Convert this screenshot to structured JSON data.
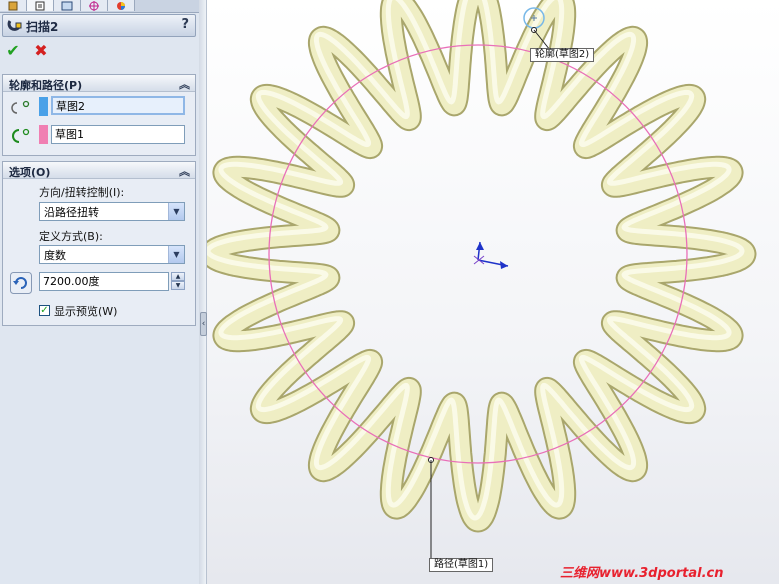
{
  "feature": {
    "title": "扫描2",
    "help": "?"
  },
  "tabs": [
    "feature-manager-icon",
    "property-manager-icon",
    "configuration-manager-icon",
    "dimxpert-icon",
    "display-manager-icon"
  ],
  "profile_path": {
    "header": "轮廓和路径(P)",
    "profile_value": "草图2",
    "path_value": "草图1",
    "profile_color": "#4aa1e8",
    "path_color": "#f07fb2"
  },
  "options": {
    "header": "选项(O)",
    "orientation_label": "方向/扭转控制(I):",
    "orientation_value": "沿路径扭转",
    "define_label": "定义方式(B):",
    "define_value": "度数",
    "degrees_value": "7200.00度",
    "preview_label": "显示预览(W)",
    "preview_checked": true
  },
  "callouts": {
    "profile": "轮廓(草图2)",
    "path": "路径(草图1)"
  },
  "watermark": "三维网www.3dportal.cn",
  "colors": {
    "spring": "#efeec4",
    "path_circle": "#e96fb8",
    "accent_ok": "#21a121",
    "accent_cancel": "#d42020"
  }
}
